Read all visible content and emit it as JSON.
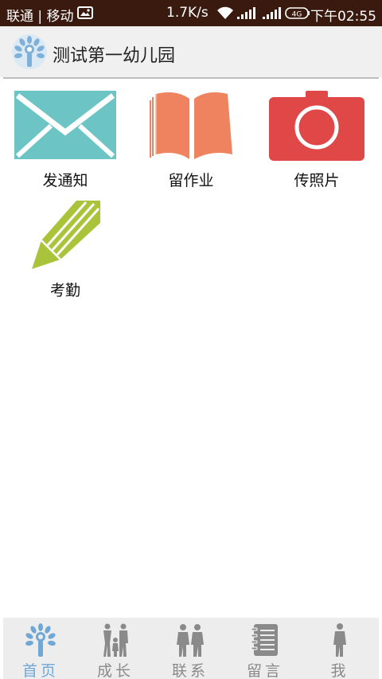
{
  "status_bar": {
    "carrier": "联通 | 移动",
    "speed": "1.7K/s",
    "network_badge": "4G",
    "time": "下午02:55"
  },
  "header": {
    "title": "测试第一幼儿园"
  },
  "grid": [
    {
      "label": "发通知",
      "icon": "envelope-icon",
      "color": "#6cc4c5"
    },
    {
      "label": "留作业",
      "icon": "book-icon",
      "color": "#ef835f"
    },
    {
      "label": "传照片",
      "icon": "camera-icon",
      "color": "#e04848"
    },
    {
      "label": "考勤",
      "icon": "pencil-icon",
      "color": "#a9c43a"
    }
  ],
  "bottom_nav": [
    {
      "label": "首页",
      "icon": "home-tree-icon",
      "active": true
    },
    {
      "label": "成长",
      "icon": "family-icon",
      "active": false
    },
    {
      "label": "联系",
      "icon": "couple-icon",
      "active": false
    },
    {
      "label": "留言",
      "icon": "notebook-icon",
      "active": false
    },
    {
      "label": "我",
      "icon": "person-icon",
      "active": false
    }
  ],
  "colors": {
    "status_bar_bg": "#3a1a0f",
    "header_bg": "#f0f0f0",
    "active_nav": "#6fa8d6",
    "inactive_nav": "#8a8a8a"
  }
}
